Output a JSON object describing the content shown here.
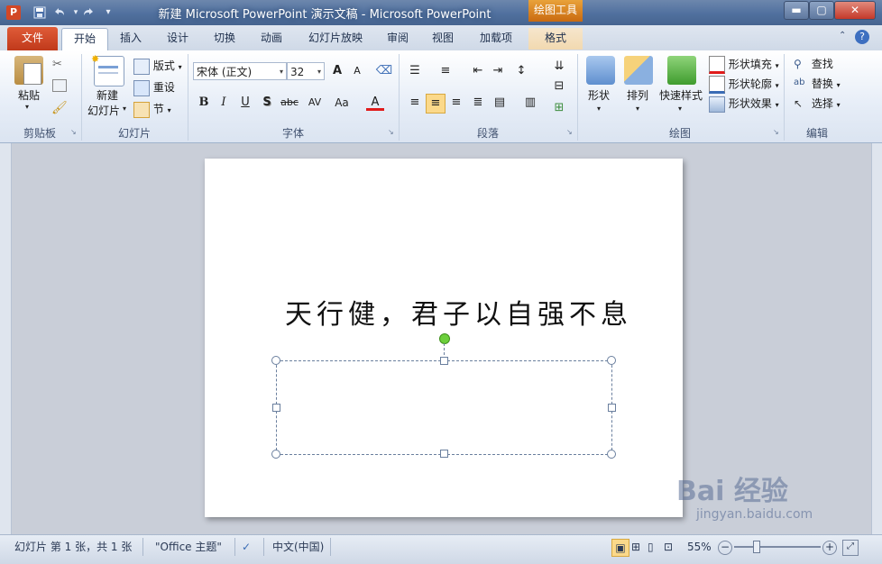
{
  "window": {
    "title": "新建 Microsoft PowerPoint 演示文稿  -  Microsoft PowerPoint",
    "app_icon_letter": "P",
    "contextual_tab_group": "绘图工具",
    "controls": {
      "minimize": "▬",
      "maximize": "▢",
      "close": "✕"
    }
  },
  "quick_access": {
    "save_icon": "save-icon",
    "undo_icon": "undo-icon",
    "redo_icon": "redo-icon",
    "customize_icon": "customize-qat-icon"
  },
  "tabs": [
    {
      "label": "文件"
    },
    {
      "label": "开始"
    },
    {
      "label": "插入"
    },
    {
      "label": "设计"
    },
    {
      "label": "切换"
    },
    {
      "label": "动画"
    },
    {
      "label": "幻灯片放映"
    },
    {
      "label": "审阅"
    },
    {
      "label": "视图"
    },
    {
      "label": "加载项"
    },
    {
      "label": "格式"
    }
  ],
  "ribbon": {
    "clipboard": {
      "label": "剪贴板",
      "paste": "粘贴"
    },
    "slides": {
      "label": "幻灯片",
      "new_slide_line1": "新建",
      "new_slide_line2": "幻灯片",
      "layout": "版式",
      "reset": "重设",
      "section": "节"
    },
    "font": {
      "label": "字体",
      "font_name": "宋体 (正文)",
      "font_size": "32",
      "bold": "B",
      "italic": "I",
      "underline": "U",
      "shadow": "S",
      "strike": "abc",
      "spacing": "AV",
      "case": "Aa",
      "color": "A",
      "grow": "A",
      "shrink": "A"
    },
    "paragraph": {
      "label": "段落"
    },
    "drawing": {
      "label": "绘图",
      "shapes": "形状",
      "arrange": "排列",
      "quick_styles": "快速样式",
      "shape_fill": "形状填充",
      "shape_outline": "形状轮廓",
      "shape_effects": "形状效果"
    },
    "editing": {
      "label": "编辑",
      "find": "查找",
      "replace": "替换",
      "select": "选择"
    }
  },
  "slide": {
    "text": "天行健，君子以自强不息"
  },
  "status": {
    "slide_info": "幻灯片 第 1 张，共 1 张",
    "theme": "\"Office 主题\"",
    "language": "中文(中国)",
    "zoom": "55%",
    "zoom_level": 0.55
  },
  "watermark": {
    "text": "Bai 经验",
    "url": "jingyan.baidu.com"
  },
  "colors": {
    "accent": "#c0391b",
    "title_bar": "#50709e",
    "contextual": "#e9a23a"
  }
}
